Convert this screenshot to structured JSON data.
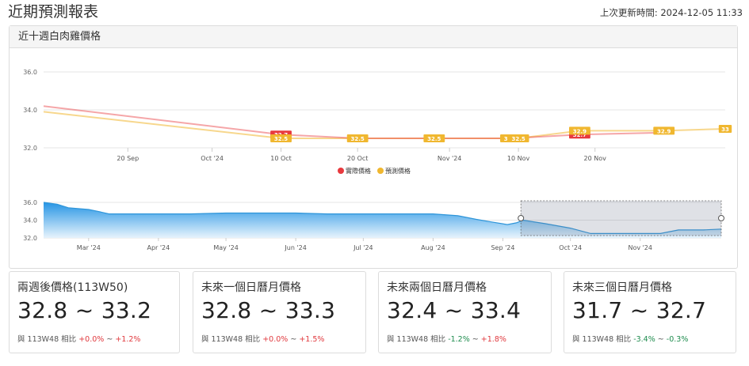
{
  "header": {
    "title": "近期預測報表",
    "updated_label": "上次更新時間:",
    "updated_value": "2024-12-05 11:33"
  },
  "chart_card": {
    "title": "近十週白肉雞價格"
  },
  "colors": {
    "actual": "#e8393e",
    "forecast": "#f0b72f",
    "navigator": "#2e95d9",
    "up": "#e0393e",
    "down": "#1e8c4e"
  },
  "chart_data": [
    {
      "type": "line",
      "y_ticks": [
        "36.0",
        "34.0",
        "32.0"
      ],
      "ylim": [
        32.0,
        36.0
      ],
      "x_ticks": [
        "20 Sep",
        "Oct '24",
        "10 Oct",
        "20 Oct",
        "Nov '24",
        "10 Nov",
        "20 Nov"
      ],
      "x_tick_dates": [
        "2024-09-20",
        "2024-10-01",
        "2024-10-10",
        "2024-10-20",
        "2024-11-01",
        "2024-11-10",
        "2024-11-20"
      ],
      "xlim": [
        "2024-09-09",
        "2024-12-07"
      ],
      "legend": [
        "實際價格",
        "預測價格"
      ],
      "legend_position": "bottom-center",
      "series": [
        {
          "name": "實際價格",
          "x": [
            "2024-09-09",
            "2024-10-10",
            "2024-10-20",
            "2024-10-30",
            "2024-11-09",
            "2024-11-18",
            "2024-11-29"
          ],
          "values": [
            34.2,
            32.7,
            32.5,
            32.5,
            32.5,
            32.7,
            32.8
          ],
          "labels": [
            "",
            "32.7",
            "",
            "",
            "",
            "32.7",
            ""
          ]
        },
        {
          "name": "預測價格",
          "x": [
            "2024-09-09",
            "2024-10-10",
            "2024-10-20",
            "2024-10-30",
            "2024-11-09",
            "2024-11-10",
            "2024-11-18",
            "2024-11-29",
            "2024-12-07"
          ],
          "values": [
            33.9,
            32.5,
            32.5,
            32.5,
            32.5,
            32.5,
            32.9,
            32.9,
            33.0
          ],
          "labels": [
            "",
            "32.5",
            "32.5",
            "32.5",
            "32.5",
            "32.5",
            "32.9",
            "32.9",
            "33"
          ]
        }
      ]
    },
    {
      "type": "area",
      "y_ticks": [
        "36.0",
        "34.0",
        "32.0"
      ],
      "ylim": [
        32.0,
        36.0
      ],
      "x_ticks": [
        "Mar '24",
        "Apr '24",
        "May '24",
        "Jun '24",
        "Jul '24",
        "Aug '24",
        "Sep '24",
        "Oct '24",
        "Nov '24"
      ],
      "x_tick_dates": [
        "2024-03-01",
        "2024-04-01",
        "2024-05-01",
        "2024-06-01",
        "2024-07-01",
        "2024-08-01",
        "2024-09-01",
        "2024-10-01",
        "2024-11-01"
      ],
      "xlim": [
        "2024-02-10",
        "2024-12-07"
      ],
      "selected_range": [
        "2024-09-09",
        "2024-12-07"
      ],
      "series": [
        {
          "name": "",
          "x": [
            "2024-02-10",
            "2024-02-16",
            "2024-02-21",
            "2024-03-01",
            "2024-03-05",
            "2024-03-10",
            "2024-03-15",
            "2024-04-01",
            "2024-04-15",
            "2024-05-01",
            "2024-06-01",
            "2024-06-15",
            "2024-07-01",
            "2024-08-01",
            "2024-08-12",
            "2024-08-20",
            "2024-08-27",
            "2024-09-03",
            "2024-09-07",
            "2024-09-10",
            "2024-09-20",
            "2024-10-01",
            "2024-10-10",
            "2024-10-20",
            "2024-11-01",
            "2024-11-10",
            "2024-11-18",
            "2024-11-29",
            "2024-12-07"
          ],
          "values": [
            36.0,
            35.8,
            35.4,
            35.2,
            35.0,
            34.7,
            34.7,
            34.7,
            34.7,
            34.8,
            34.8,
            34.7,
            34.7,
            34.7,
            34.5,
            34.1,
            33.8,
            33.5,
            33.7,
            34.0,
            33.6,
            33.1,
            32.5,
            32.5,
            32.5,
            32.5,
            32.9,
            32.9,
            33.0
          ]
        }
      ]
    }
  ],
  "stats": [
    {
      "title": "兩週後價格(113W50)",
      "range": "32.8 ~ 33.2",
      "compare_prefix": "與 113W48 相比",
      "low": "+0.0%",
      "sep": "~",
      "high": "+1.2%",
      "low_dir": "up",
      "high_dir": "up"
    },
    {
      "title": "未來一個日曆月價格",
      "range": "32.8 ~ 33.3",
      "compare_prefix": "與 113W48 相比",
      "low": "+0.0%",
      "sep": "~",
      "high": "+1.5%",
      "low_dir": "up",
      "high_dir": "up"
    },
    {
      "title": "未來兩個日曆月價格",
      "range": "32.4 ~ 33.4",
      "compare_prefix": "與 113W48 相比",
      "low": "-1.2%",
      "sep": "~",
      "high": "+1.8%",
      "low_dir": "down",
      "high_dir": "up"
    },
    {
      "title": "未來三個日曆月價格",
      "range": "31.7 ~ 32.7",
      "compare_prefix": "與 113W48 相比",
      "low": "-3.4%",
      "sep": "~",
      "high": "-0.3%",
      "low_dir": "down",
      "high_dir": "down"
    }
  ]
}
